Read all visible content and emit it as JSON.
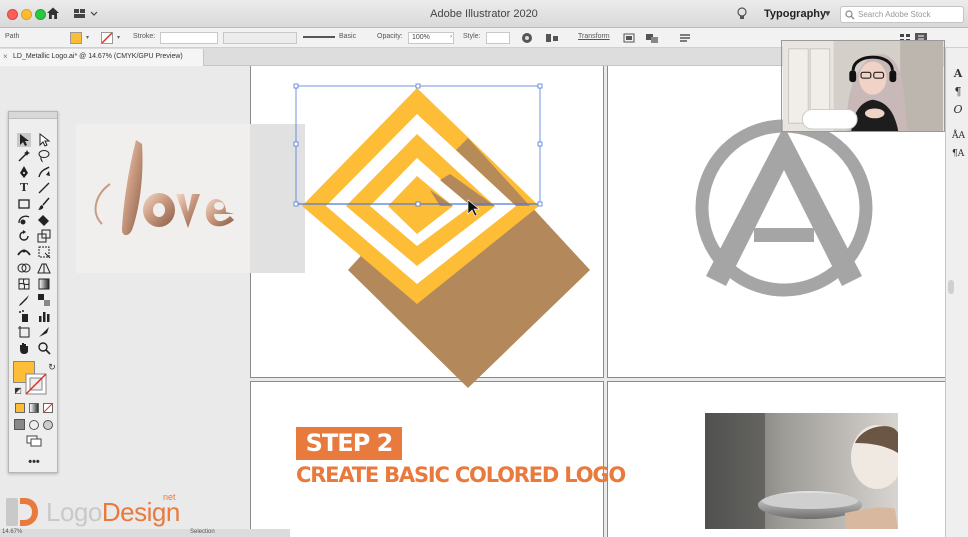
{
  "app": {
    "title": "Adobe Illustrator 2020",
    "workspace": "Typography",
    "search_placeholder": "Search Adobe Stock"
  },
  "control_bar": {
    "selection_label": "Path",
    "stroke_label": "Stroke:",
    "brush_label": "Basic",
    "opacity_label": "Opacity:",
    "opacity_value": "100%",
    "style_label": "Style:",
    "transform_label": "Transform",
    "fill_color": "#fdbd36"
  },
  "document": {
    "tab_label": "LD_Metallic Logo.ai* @ 14.67% (CMYK/GPU Preview)",
    "close_glyph": "×"
  },
  "canvas": {
    "balloon_word": "love",
    "logo_letter": "A",
    "logo_gold": "#fdbd36",
    "logo_brown": "#b3885a",
    "emblem_gray": "#a5a5a5"
  },
  "caption": {
    "step": "STEP 2",
    "title": "CREATE BASIC COLORED LOGO",
    "accent": "#e87a3d"
  },
  "brand": {
    "logo_part": "Logo",
    "design_part": "Design",
    "net_part": "net"
  },
  "status": {
    "zoom": "14.67%",
    "tool": "Selection"
  },
  "right_panel": {
    "icons": [
      "character-icon",
      "paragraph-icon",
      "opentype-icon",
      "glyphs-icon",
      "char-styles-icon"
    ]
  }
}
